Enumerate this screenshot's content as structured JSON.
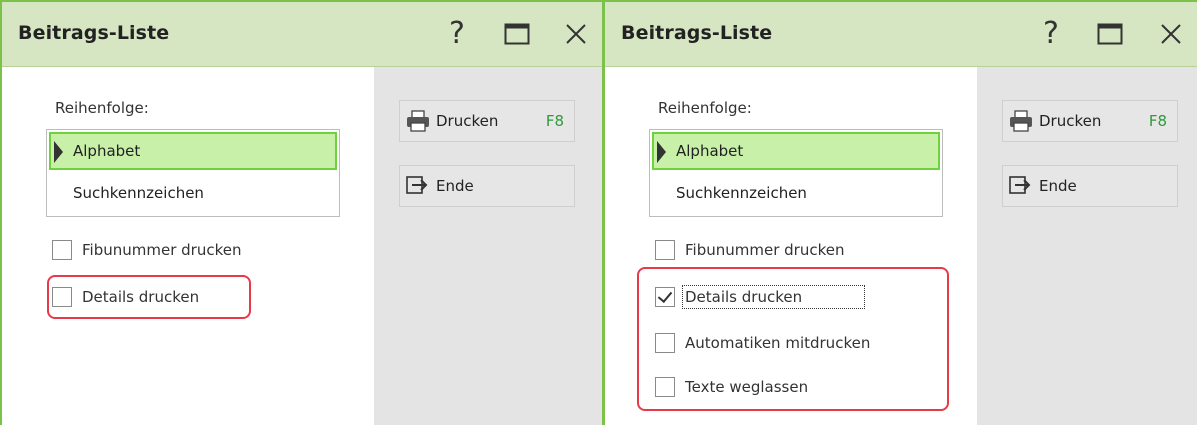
{
  "windows": [
    {
      "title": "Beitrags-Liste",
      "order_label": "Reihenfolge:",
      "list": {
        "selected": "Alphabet",
        "items": [
          "Alphabet",
          "Suchkennzeichen"
        ]
      },
      "checkboxes": [
        {
          "label": "Fibunummer drucken",
          "checked": false
        },
        {
          "label": "Details drucken",
          "checked": false
        }
      ],
      "buttons": {
        "print": "Drucken",
        "print_key": "F8",
        "end": "Ende"
      }
    },
    {
      "title": "Beitrags-Liste",
      "order_label": "Reihenfolge:",
      "list": {
        "selected": "Alphabet",
        "items": [
          "Alphabet",
          "Suchkennzeichen"
        ]
      },
      "checkboxes": [
        {
          "label": "Fibunummer drucken",
          "checked": false
        },
        {
          "label": "Details drucken",
          "checked": true
        },
        {
          "label": "Automatiken mitdrucken",
          "checked": false
        },
        {
          "label": "Texte weglassen",
          "checked": false
        }
      ],
      "buttons": {
        "print": "Drucken",
        "print_key": "F8",
        "end": "Ende"
      }
    }
  ],
  "colors": {
    "accent": "#7cc24a",
    "title_bg": "#d6e6c2",
    "selection": "#c8f0a8",
    "highlight": "#e8394a",
    "shortcut": "#2e9a3a"
  },
  "icons": [
    "help-icon",
    "maximize-icon",
    "close-icon",
    "printer-icon",
    "exit-icon",
    "selection-marker-icon"
  ]
}
